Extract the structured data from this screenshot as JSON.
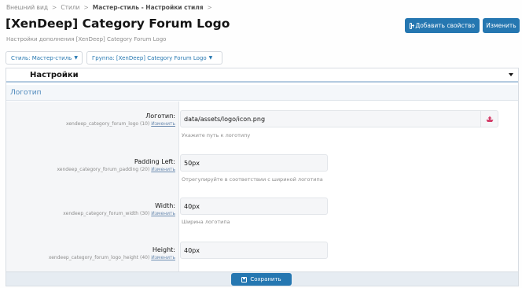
{
  "breadcrumb": {
    "items": [
      "Внешний вид",
      "Стили",
      "Мастер-стиль - Настройки стиля"
    ],
    "separator": ">"
  },
  "header": {
    "title": "[XenDeep] Category Forum Logo",
    "description": "Настройки дополнения [XenDeep] Category Forum Logo",
    "add_property_label": "Добавить свойство",
    "edit_label": "Изменить"
  },
  "filters": {
    "style_label": "Стиль: Мастер-стиль",
    "group_label": "Группа: [XenDeep] Category Forum Logo"
  },
  "block": {
    "header_title": "Настройки",
    "section_title": "Логотип"
  },
  "rows": [
    {
      "label": "Логотип:",
      "key": "xendeep_category_forum_logo (10)",
      "edit_link": "Изменить",
      "value": "data/assets/logo/icon.png",
      "hint": "Укажите путь к логотипу"
    },
    {
      "label": "Padding Left:",
      "key": "xendeep_category_forum_padding (20)",
      "edit_link": "Изменить",
      "value": "50px",
      "hint": "Отрегулируйте в соответствии с шириной логотипа"
    },
    {
      "label": "Width:",
      "key": "xendeep_category_forum_width (30)",
      "edit_link": "Изменить",
      "value": "40px",
      "hint": "Ширина логотипа"
    },
    {
      "label": "Height:",
      "key": "xendeep_category_forum_logo_height (40)",
      "edit_link": "Изменить",
      "value": "40px",
      "hint": ""
    }
  ],
  "footer": {
    "save_label": "Сохранить"
  },
  "colors": {
    "primary": "#2577b1",
    "section_title": "#4c87bb",
    "upload_icon": "#d33f6a"
  },
  "icons": {
    "add": "plus-square-icon",
    "upload": "upload-icon",
    "save": "save-icon",
    "dropdown": "caret-down-icon"
  }
}
